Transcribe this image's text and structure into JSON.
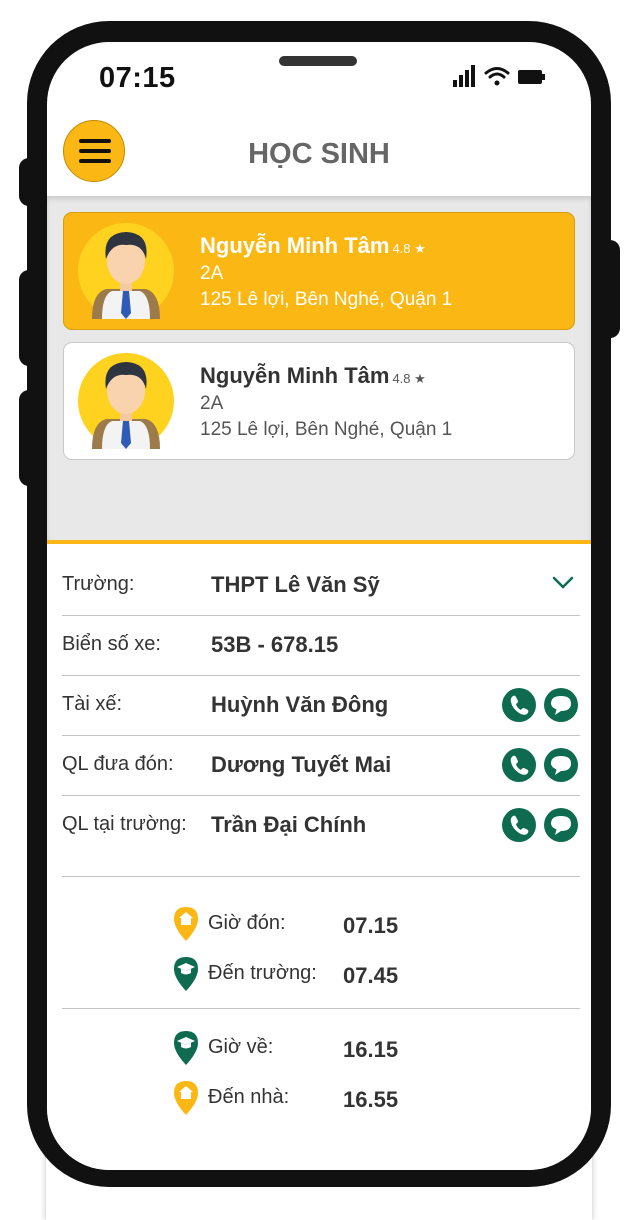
{
  "status_bar": {
    "time": "07:15",
    "icons": [
      "signal-icon",
      "wifi-icon",
      "battery-icon"
    ]
  },
  "header": {
    "title": "HỌC SINH",
    "menu_icon": "hamburger-menu-icon"
  },
  "students": [
    {
      "name": "Nguyễn Minh Tâm",
      "rating": "4.8 ★",
      "class": "2A",
      "address": "125 Lê lợi, Bên Nghé, Quận 1",
      "selected": true
    },
    {
      "name": "Nguyễn Minh Tâm",
      "rating": "4.8 ★",
      "class": "2A",
      "address": "125 Lê lợi, Bên Nghé, Quận 1",
      "selected": false
    }
  ],
  "details": {
    "school": {
      "label": "Trường:",
      "value": "THPT Lê Văn Sỹ"
    },
    "plate": {
      "label": "Biển số xe:",
      "value": "53B - 678.15"
    },
    "driver": {
      "label": "Tài xế:",
      "value": "Huỳnh Văn Đông"
    },
    "pickup_manager": {
      "label": "QL đưa đón:",
      "value": "Dương Tuyết Mai"
    },
    "school_manager": {
      "label": "QL tại trường:",
      "value": "Trần Đại Chính"
    }
  },
  "schedule": {
    "pickup": {
      "label": "Giờ đón:",
      "value": "07.15"
    },
    "arrive_school": {
      "label": "Đến trường:",
      "value": "07.45"
    },
    "return": {
      "label": "Giờ về:",
      "value": "16.15"
    },
    "arrive_home": {
      "label": "Đến nhà:",
      "value": "16.55"
    }
  },
  "colors": {
    "accent": "#FBB815",
    "green": "#0E6B4F",
    "text": "#333333"
  }
}
